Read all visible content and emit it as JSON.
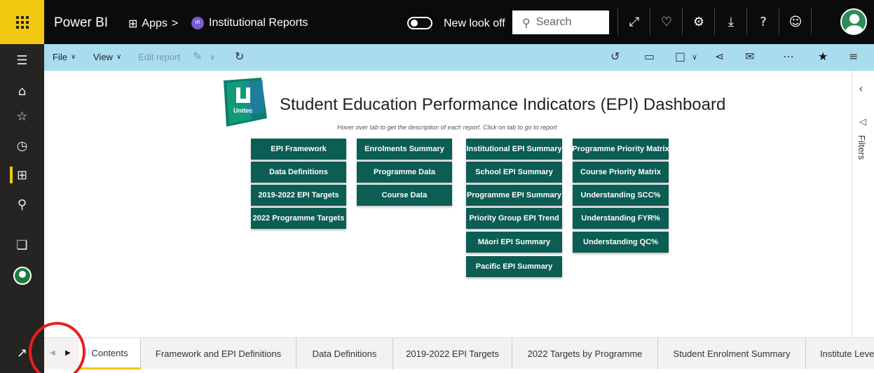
{
  "app": {
    "title": "Power BI",
    "apps_label": "Apps",
    "breadcrumb_sep": ">",
    "report_badge": "IR",
    "report_name": "Institutional Reports",
    "new_look_label": "New look off",
    "search_placeholder": "Search"
  },
  "actionbar": {
    "file_label": "File",
    "view_label": "View",
    "edit_report_label": "Edit report"
  },
  "dashboard": {
    "logo_text": "Unitec",
    "title": "Student Education Performance Indicators (EPI) Dashboard",
    "subtitle": "Hover over tab to get the description of each report.  Click on tab to go to report",
    "tiles": {
      "col1": [
        "EPI Framework",
        "Data Definitions",
        "2019-2022 EPI Targets",
        "2022 Programme Targets"
      ],
      "col2": [
        "Enrolments Summary",
        "Programme Data",
        "Course Data"
      ],
      "col3": [
        "Institutional EPI Summary",
        "School EPI Summary",
        "Programme EPI Summary",
        "Priority Group EPI Trend",
        "Māori EPI Summary",
        "Pacific EPI Summary"
      ],
      "col4": [
        "Programme Priority Matrix",
        "Course Priority Matrix",
        "Understanding SCC%",
        "Understanding FYR%",
        "Understanding QC%"
      ]
    }
  },
  "filters": {
    "label": "Filters"
  },
  "tabs": [
    "Contents",
    "Framework and EPI Definitions",
    "Data Definitions",
    "2019-2022 EPI Targets",
    "2022 Targets by Programme",
    "Student Enrolment Summary",
    "Institute Leve"
  ],
  "colors": {
    "accent": "#f2c811",
    "tile": "#0c5d53",
    "actionbar": "#a9dcef",
    "annotation": "#e81e1e"
  }
}
